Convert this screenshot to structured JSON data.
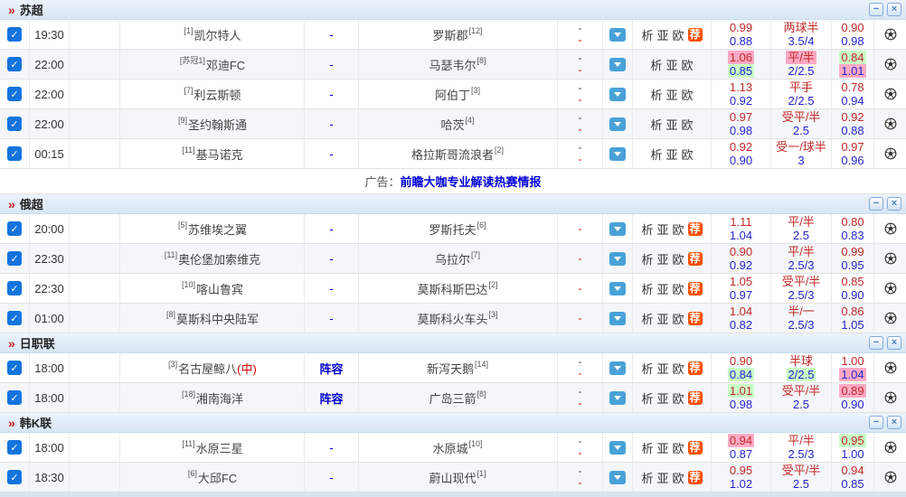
{
  "window_controls": {
    "minimize": "−",
    "close": "×"
  },
  "panel": {
    "links": [
      "析",
      "亚",
      "欧"
    ],
    "recommend": "荐"
  },
  "ad": {
    "label": "广告：",
    "link": "前瞻大咖专业解读热赛情报"
  },
  "colors": {
    "header_bg": "#dce9f6",
    "accent_blue": "#48a2d8",
    "checkbox_blue": "#1374dd",
    "badge_orange": "#ff4f00",
    "red_text": "#c22828",
    "blue_text": "#2525cc",
    "pink_highlight": "#ffaac5",
    "green_highlight": "#c9fdc5",
    "link_blue": "#0000cf",
    "score_red": "#e80000"
  },
  "sections": [
    {
      "league": "苏超",
      "has_ad": true,
      "matches": [
        {
          "time": "19:30",
          "home_rank": "[1]",
          "home": "凯尔特人",
          "home_mark": "",
          "mid": "-",
          "away": "罗斯郡",
          "away_rank": "[12]",
          "score": "double",
          "recommend": true,
          "cols": [
            {
              "top": "0.99",
              "bottom": "0.88",
              "top_hl": "",
              "bottom_hl": ""
            },
            {
              "top": "两球半",
              "bottom": "3.5/4",
              "top_hl": "",
              "bottom_hl": ""
            },
            {
              "top": "0.90",
              "bottom": "0.98",
              "top_hl": "",
              "bottom_hl": ""
            }
          ]
        },
        {
          "time": "22:00",
          "home_rank": "[苏冠1]",
          "home": "邓迪FC",
          "home_mark": "",
          "mid": "-",
          "away": "马瑟韦尔",
          "away_rank": "[8]",
          "score": "double",
          "recommend": false,
          "cols": [
            {
              "top": "1.06",
              "bottom": "0.85",
              "top_hl": "pink",
              "bottom_hl": "green"
            },
            {
              "top": "平/半",
              "bottom": "2/2.5",
              "top_hl": "pink",
              "bottom_hl": ""
            },
            {
              "top": "0.84",
              "bottom": "1.01",
              "top_hl": "green",
              "bottom_hl": "pink"
            }
          ]
        },
        {
          "time": "22:00",
          "home_rank": "[7]",
          "home": "利云斯顿",
          "home_mark": "",
          "mid": "-",
          "away": "阿伯丁",
          "away_rank": "[3]",
          "score": "double",
          "recommend": false,
          "cols": [
            {
              "top": "1.13",
              "bottom": "0.92",
              "top_hl": "",
              "bottom_hl": ""
            },
            {
              "top": "平手",
              "bottom": "2/2.5",
              "top_hl": "",
              "bottom_hl": ""
            },
            {
              "top": "0.78",
              "bottom": "0.94",
              "top_hl": "",
              "bottom_hl": ""
            }
          ]
        },
        {
          "time": "22:00",
          "home_rank": "[9]",
          "home": "圣约翰斯通",
          "home_mark": "",
          "mid": "-",
          "away": "哈茨",
          "away_rank": "[4]",
          "score": "double",
          "recommend": false,
          "cols": [
            {
              "top": "0.97",
              "bottom": "0.98",
              "top_hl": "",
              "bottom_hl": ""
            },
            {
              "top": "受平/半",
              "bottom": "2.5",
              "top_hl": "",
              "bottom_hl": ""
            },
            {
              "top": "0.92",
              "bottom": "0.88",
              "top_hl": "",
              "bottom_hl": ""
            }
          ]
        },
        {
          "time": "00:15",
          "home_rank": "[11]",
          "home": "基马诺克",
          "home_mark": "",
          "mid": "-",
          "away": "格拉斯哥流浪者",
          "away_rank": "[2]",
          "score": "double",
          "recommend": false,
          "cols": [
            {
              "top": "0.92",
              "bottom": "0.90",
              "top_hl": "",
              "bottom_hl": ""
            },
            {
              "top": "受一/球半",
              "bottom": "3",
              "top_hl": "",
              "bottom_hl": ""
            },
            {
              "top": "0.97",
              "bottom": "0.96",
              "top_hl": "",
              "bottom_hl": ""
            }
          ]
        }
      ]
    },
    {
      "league": "俄超",
      "has_ad": false,
      "matches": [
        {
          "time": "20:00",
          "home_rank": "[5]",
          "home": "苏维埃之翼",
          "home_mark": "",
          "mid": "-",
          "away": "罗斯托夫",
          "away_rank": "[6]",
          "score": "single",
          "recommend": true,
          "cols": [
            {
              "top": "1.11",
              "bottom": "1.04",
              "top_hl": "",
              "bottom_hl": ""
            },
            {
              "top": "平/半",
              "bottom": "2.5",
              "top_hl": "",
              "bottom_hl": ""
            },
            {
              "top": "0.80",
              "bottom": "0.83",
              "top_hl": "",
              "bottom_hl": ""
            }
          ]
        },
        {
          "time": "22:30",
          "home_rank": "[11]",
          "home": "奥伦堡加索维克",
          "home_mark": "",
          "mid": "-",
          "away": "乌拉尔",
          "away_rank": "[7]",
          "score": "single",
          "recommend": true,
          "cols": [
            {
              "top": "0.90",
              "bottom": "0.92",
              "top_hl": "",
              "bottom_hl": ""
            },
            {
              "top": "平/半",
              "bottom": "2.5/3",
              "top_hl": "",
              "bottom_hl": ""
            },
            {
              "top": "0.99",
              "bottom": "0.95",
              "top_hl": "",
              "bottom_hl": ""
            }
          ]
        },
        {
          "time": "22:30",
          "home_rank": "[10]",
          "home": "喀山鲁宾",
          "home_mark": "",
          "mid": "-",
          "away": "莫斯科斯巴达",
          "away_rank": "[2]",
          "score": "single",
          "recommend": true,
          "cols": [
            {
              "top": "1.05",
              "bottom": "0.97",
              "top_hl": "",
              "bottom_hl": ""
            },
            {
              "top": "受平/半",
              "bottom": "2.5/3",
              "top_hl": "",
              "bottom_hl": ""
            },
            {
              "top": "0.85",
              "bottom": "0.90",
              "top_hl": "",
              "bottom_hl": ""
            }
          ]
        },
        {
          "time": "01:00",
          "home_rank": "[8]",
          "home": "莫斯科中央陆军",
          "home_mark": "",
          "mid": "-",
          "away": "莫斯科火车头",
          "away_rank": "[3]",
          "score": "single",
          "recommend": true,
          "cols": [
            {
              "top": "1.04",
              "bottom": "0.82",
              "top_hl": "",
              "bottom_hl": ""
            },
            {
              "top": "半/一",
              "bottom": "2.5/3",
              "top_hl": "",
              "bottom_hl": ""
            },
            {
              "top": "0.86",
              "bottom": "1.05",
              "top_hl": "",
              "bottom_hl": ""
            }
          ]
        }
      ]
    },
    {
      "league": "日职联",
      "has_ad": false,
      "matches": [
        {
          "time": "18:00",
          "home_rank": "[3]",
          "home": "名古屋鲸八",
          "home_mark": "(中)",
          "mid": "阵容",
          "away": "新泻天鹅",
          "away_rank": "[14]",
          "score": "double",
          "recommend": true,
          "cols": [
            {
              "top": "0.90",
              "bottom": "0.84",
              "top_hl": "",
              "bottom_hl": "green"
            },
            {
              "top": "半球",
              "bottom": "2/2.5",
              "top_hl": "",
              "bottom_hl": "green"
            },
            {
              "top": "1.00",
              "bottom": "1.04",
              "top_hl": "",
              "bottom_hl": "pink"
            }
          ]
        },
        {
          "time": "18:00",
          "home_rank": "[18]",
          "home": "湘南海洋",
          "home_mark": "",
          "mid": "阵容",
          "away": "广岛三箭",
          "away_rank": "[8]",
          "score": "double",
          "recommend": true,
          "cols": [
            {
              "top": "1.01",
              "bottom": "0.98",
              "top_hl": "green",
              "bottom_hl": ""
            },
            {
              "top": "受平/半",
              "bottom": "2.5",
              "top_hl": "",
              "bottom_hl": ""
            },
            {
              "top": "0.89",
              "bottom": "0.90",
              "top_hl": "pink",
              "bottom_hl": ""
            }
          ]
        }
      ]
    },
    {
      "league": "韩K联",
      "has_ad": false,
      "matches": [
        {
          "time": "18:00",
          "home_rank": "[11]",
          "home": "水原三星",
          "home_mark": "",
          "mid": "-",
          "away": "水原城",
          "away_rank": "[10]",
          "score": "double",
          "recommend": true,
          "cols": [
            {
              "top": "0.94",
              "bottom": "0.87",
              "top_hl": "pink",
              "bottom_hl": ""
            },
            {
              "top": "平/半",
              "bottom": "2.5/3",
              "top_hl": "",
              "bottom_hl": ""
            },
            {
              "top": "0.95",
              "bottom": "1.00",
              "top_hl": "green",
              "bottom_hl": ""
            }
          ]
        },
        {
          "time": "18:30",
          "home_rank": "[6]",
          "home": "大邱FC",
          "home_mark": "",
          "mid": "-",
          "away": "蔚山现代",
          "away_rank": "[1]",
          "score": "double",
          "recommend": true,
          "cols": [
            {
              "top": "0.95",
              "bottom": "1.02",
              "top_hl": "",
              "bottom_hl": ""
            },
            {
              "top": "受平/半",
              "bottom": "2.5",
              "top_hl": "",
              "bottom_hl": ""
            },
            {
              "top": "0.94",
              "bottom": "0.85",
              "top_hl": "",
              "bottom_hl": ""
            }
          ]
        }
      ]
    }
  ]
}
